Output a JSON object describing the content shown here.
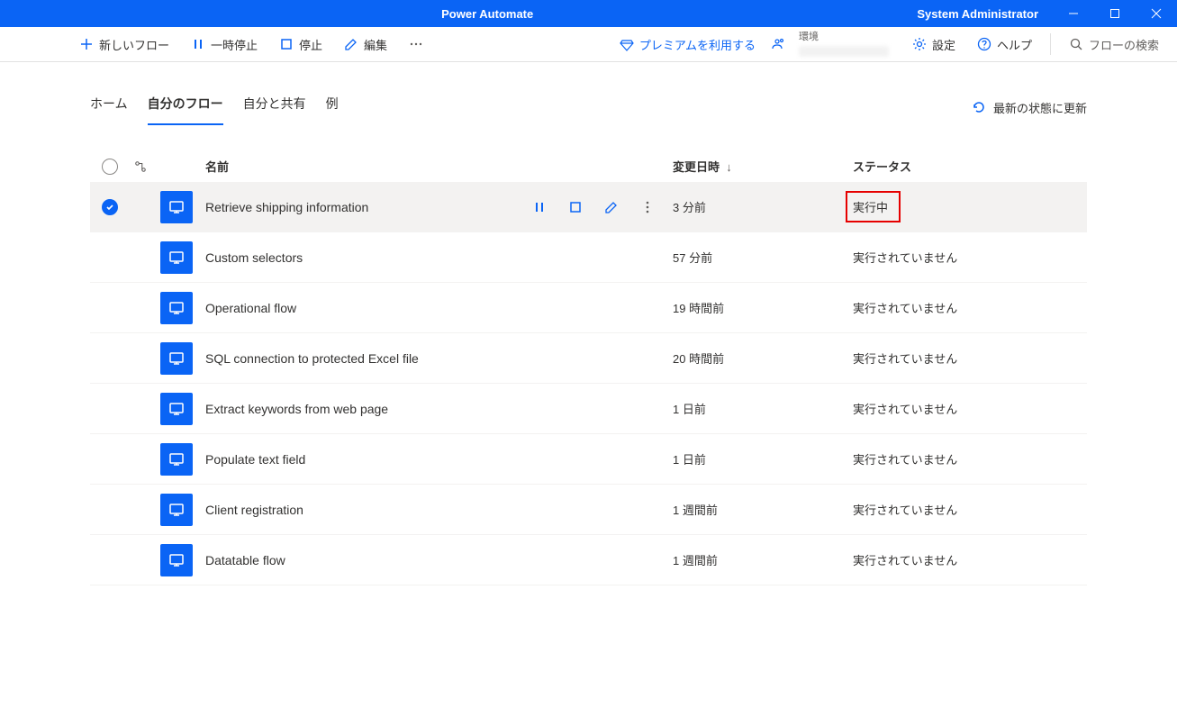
{
  "titlebar": {
    "title": "Power Automate",
    "user": "System Administrator"
  },
  "toolbar": {
    "new_flow": "新しいフロー",
    "pause": "一時停止",
    "stop": "停止",
    "edit": "編集",
    "premium": "プレミアムを利用する",
    "env_label": "環境",
    "settings": "設定",
    "help": "ヘルプ",
    "search_placeholder": "フローの検索"
  },
  "tabs": {
    "home": "ホーム",
    "my_flows": "自分のフロー",
    "shared": "自分と共有",
    "examples": "例"
  },
  "refresh": "最新の状態に更新",
  "columns": {
    "name": "名前",
    "modified": "変更日時",
    "status": "ステータス"
  },
  "rows": [
    {
      "name": "Retrieve shipping information",
      "modified": "3 分前",
      "status": "実行中",
      "selected": true,
      "highlight": true
    },
    {
      "name": "Custom selectors",
      "modified": "57 分前",
      "status": "実行されていません"
    },
    {
      "name": "Operational flow",
      "modified": "19 時間前",
      "status": "実行されていません"
    },
    {
      "name": "SQL connection to protected Excel file",
      "modified": "20 時間前",
      "status": "実行されていません"
    },
    {
      "name": "Extract keywords from web page",
      "modified": "1 日前",
      "status": "実行されていません"
    },
    {
      "name": "Populate text field",
      "modified": "1 日前",
      "status": "実行されていません"
    },
    {
      "name": "Client registration",
      "modified": "1 週間前",
      "status": "実行されていません"
    },
    {
      "name": "Datatable flow",
      "modified": "1 週間前",
      "status": "実行されていません"
    }
  ]
}
